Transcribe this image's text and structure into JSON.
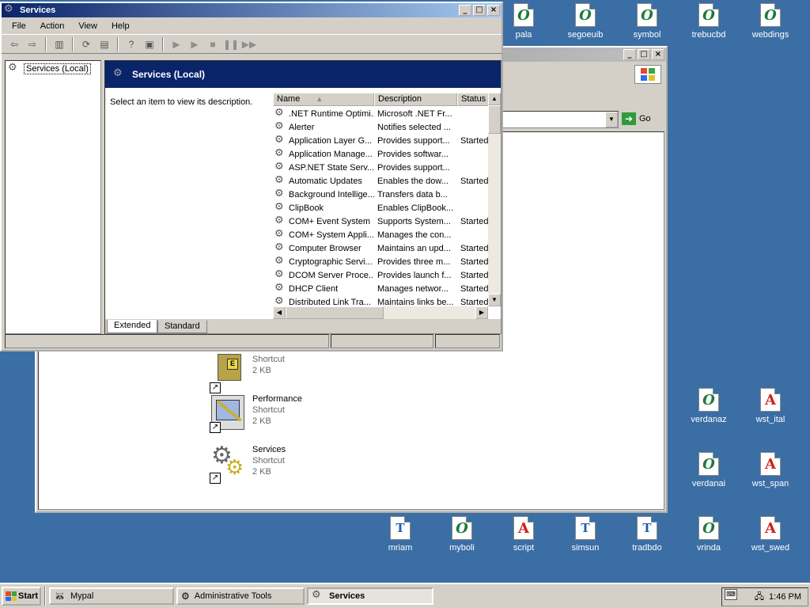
{
  "desktop_icons": [
    {
      "label": "pala",
      "type": "o"
    },
    {
      "label": "segoeuib",
      "type": "o"
    },
    {
      "label": "symbol",
      "type": "o"
    },
    {
      "label": "trebucbd",
      "type": "o"
    },
    {
      "label": "webdings",
      "type": "o"
    },
    {
      "label": "verdanaz",
      "type": "o"
    },
    {
      "label": "wst_ital",
      "type": "a"
    },
    {
      "label": "verdanai",
      "type": "o"
    },
    {
      "label": "wst_span",
      "type": "a"
    },
    {
      "label": "mriam",
      "type": "t"
    },
    {
      "label": "myboli",
      "type": "o"
    },
    {
      "label": "script",
      "type": "a"
    },
    {
      "label": "simsun",
      "type": "t"
    },
    {
      "label": "tradbdo",
      "type": "t"
    },
    {
      "label": "vrinda",
      "type": "o"
    },
    {
      "label": "wst_swed",
      "type": "a"
    }
  ],
  "explorer": {
    "go_label": "Go",
    "shortcuts": [
      {
        "name": "",
        "type": "Shortcut",
        "size": "2 KB"
      },
      {
        "name": "Performance",
        "type": "Shortcut",
        "size": "2 KB"
      },
      {
        "name": "Services",
        "type": "Shortcut",
        "size": "2 KB"
      }
    ]
  },
  "services": {
    "title": "Services",
    "menu": [
      "File",
      "Action",
      "View",
      "Help"
    ],
    "tree_root": "Services (Local)",
    "banner": "Services (Local)",
    "description_prompt": "Select an item to view its description.",
    "columns": {
      "name": "Name",
      "description": "Description",
      "status": "Status"
    },
    "rows": [
      {
        "name": ".NET Runtime Optimi...",
        "description": "Microsoft .NET Fr...",
        "status": ""
      },
      {
        "name": "Alerter",
        "description": "Notifies selected ...",
        "status": ""
      },
      {
        "name": "Application Layer G...",
        "description": "Provides support...",
        "status": "Started"
      },
      {
        "name": "Application Manage...",
        "description": "Provides softwar...",
        "status": ""
      },
      {
        "name": "ASP.NET State Serv...",
        "description": "Provides support...",
        "status": ""
      },
      {
        "name": "Automatic Updates",
        "description": "Enables the dow...",
        "status": "Started"
      },
      {
        "name": "Background Intellige...",
        "description": "Transfers data b...",
        "status": ""
      },
      {
        "name": "ClipBook",
        "description": "Enables ClipBook...",
        "status": ""
      },
      {
        "name": "COM+ Event System",
        "description": "Supports System...",
        "status": "Started"
      },
      {
        "name": "COM+ System Appli...",
        "description": "Manages the con...",
        "status": ""
      },
      {
        "name": "Computer Browser",
        "description": "Maintains an upd...",
        "status": "Started"
      },
      {
        "name": "Cryptographic Servi...",
        "description": "Provides three m...",
        "status": "Started"
      },
      {
        "name": "DCOM Server Proce...",
        "description": "Provides launch f...",
        "status": "Started"
      },
      {
        "name": "DHCP Client",
        "description": "Manages networ...",
        "status": "Started"
      },
      {
        "name": "Distributed Link Tra...",
        "description": "Maintains links be...",
        "status": "Started"
      }
    ],
    "tabs": {
      "extended": "Extended",
      "standard": "Standard"
    }
  },
  "taskbar": {
    "start": "Start",
    "tasks": [
      "Mypal",
      "Administrative Tools",
      "Services"
    ],
    "clock": "1:46 PM"
  }
}
